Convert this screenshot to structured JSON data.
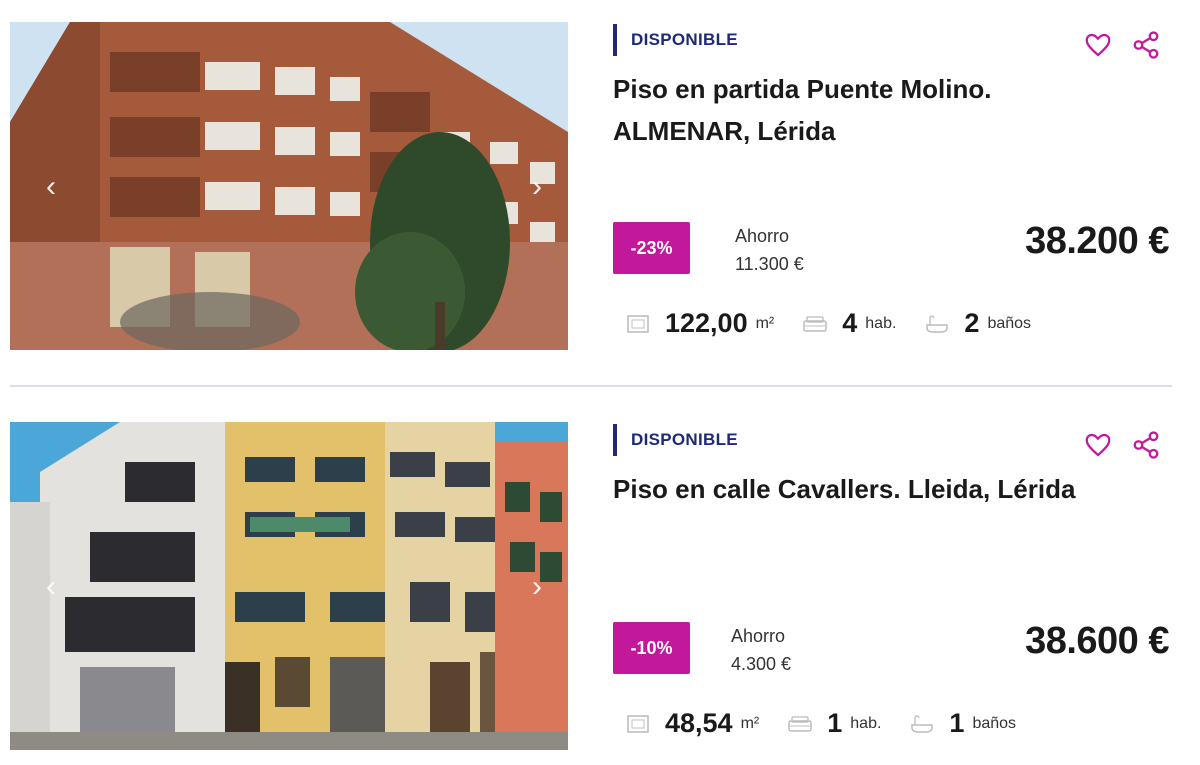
{
  "listings": [
    {
      "status": "DISPONIBLE",
      "title": "Piso en partida Puente Molino. ALMENAR, Lérida",
      "discount": "-23%",
      "saving_label": "Ahorro",
      "saving_value": "11.300 €",
      "price": "38.200 €",
      "area_value": "122,00",
      "area_unit": "m²",
      "rooms_value": "4",
      "rooms_unit": "hab.",
      "baths_value": "2",
      "baths_unit": "baños"
    },
    {
      "status": "DISPONIBLE",
      "title": "Piso en calle Cavallers. Lleida, Lérida",
      "discount": "-10%",
      "saving_label": "Ahorro",
      "saving_value": "4.300 €",
      "price": "38.600 €",
      "area_value": "48,54",
      "area_unit": "m²",
      "rooms_value": "1",
      "rooms_unit": "hab.",
      "baths_value": "1",
      "baths_unit": "baños"
    }
  ],
  "colors": {
    "accent": "#c2189b",
    "status_bar": "#1e2a78",
    "divider": "#dedcef"
  },
  "icons": [
    "chevron-left-icon",
    "chevron-right-icon",
    "heart-icon",
    "share-icon",
    "area-icon",
    "bed-icon",
    "bath-icon"
  ]
}
